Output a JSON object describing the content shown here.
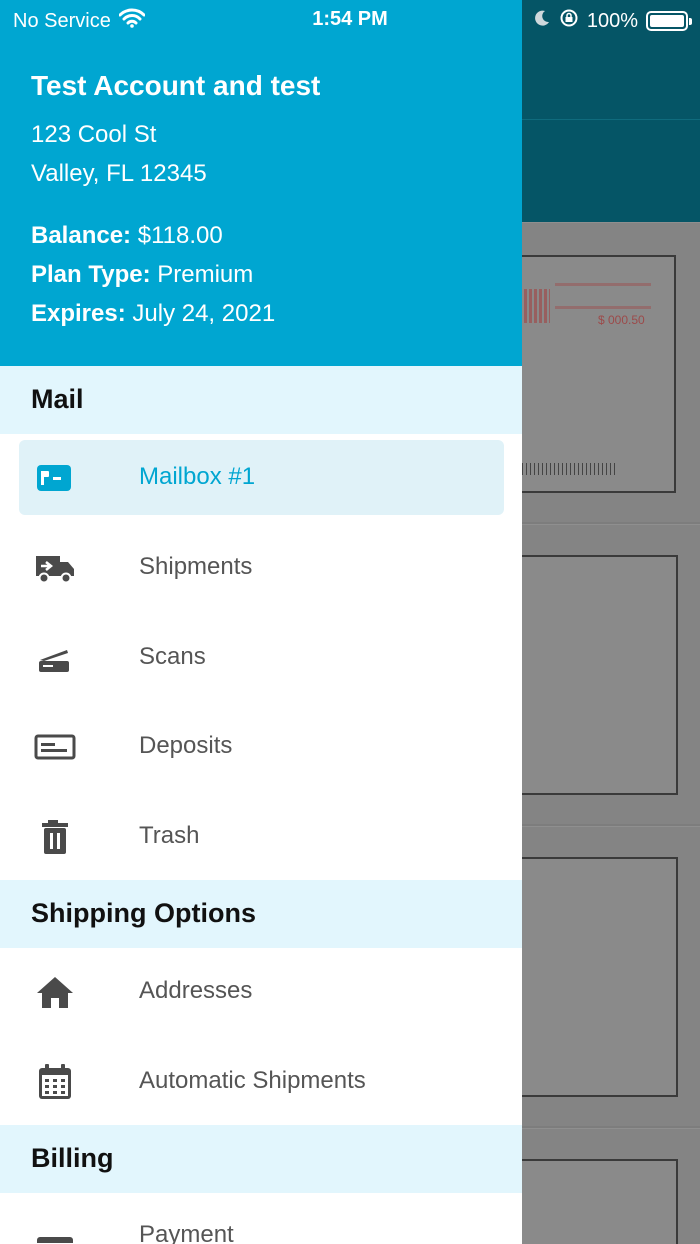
{
  "status_bar": {
    "carrier": "No Service",
    "time": "1:54 PM",
    "battery": "100%"
  },
  "account": {
    "name": "Test Account and test",
    "address_line1": "123 Cool St",
    "address_line2": "Valley, FL 12345",
    "balance_label": "Balance:",
    "balance_value": "$118.00",
    "plan_label": "Plan Type:",
    "plan_value": "Premium",
    "expires_label": "Expires:",
    "expires_value": "July 24, 2021"
  },
  "sections": {
    "mail": "Mail",
    "shipping": "Shipping Options",
    "billing": "Billing"
  },
  "menu": {
    "mailbox": "Mailbox #1",
    "shipments": "Shipments",
    "scans": "Scans",
    "deposits": "Deposits",
    "trash": "Trash",
    "addresses": "Addresses",
    "automatic_shipments": "Automatic Shipments",
    "payment": "Payment"
  },
  "background": {
    "stamp_amount": "$ 000.50"
  },
  "colors": {
    "accent": "#00a6d1",
    "section_bg": "#e2f6fd",
    "active_bg": "#e0f2f8",
    "icon": "#4a4a4a"
  }
}
